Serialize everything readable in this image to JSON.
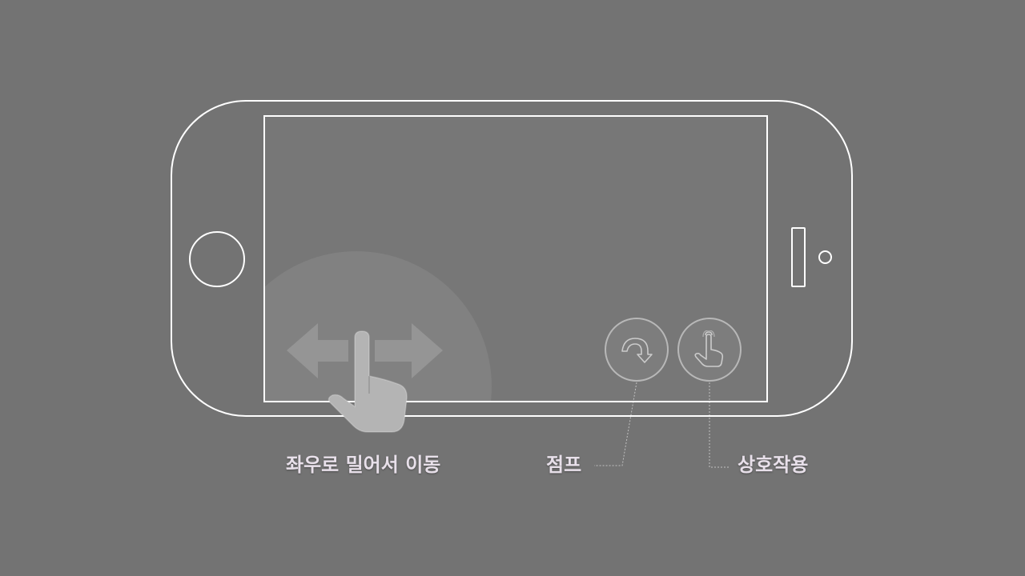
{
  "controls": {
    "move": {
      "label": "좌우로 밀어서 이동",
      "icons": [
        "left-right-arrows-icon",
        "pointing-hand-icon"
      ]
    },
    "jump": {
      "label": "점프",
      "icon": "curved-arrow-down-icon"
    },
    "interact": {
      "label": "상호작용",
      "icon": "tap-finger-icon"
    }
  },
  "colors": {
    "background": "#737373",
    "outline": "#ffffff",
    "label_text": "#e8e0ea"
  }
}
